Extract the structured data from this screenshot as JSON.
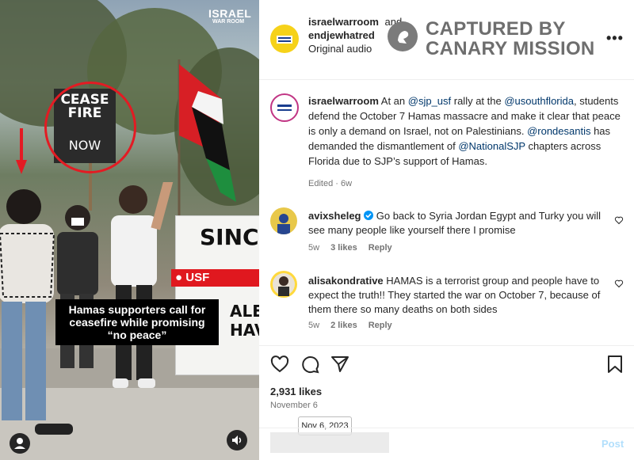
{
  "video": {
    "watermark_line1": "ISRAEL",
    "watermark_line2": "WAR ROOM",
    "sign_text_top": "CEASE FIRE",
    "sign_text_bottom": "NOW",
    "banner_text": "SINCE",
    "banner_fragment1": "ALEST",
    "banner_fragment2": "HAVE",
    "location_tag": "USF",
    "caption_line1": "Hamas supporters call for",
    "caption_line2": "ceasefire while promising",
    "caption_line3": "“no peace”",
    "accent_red": "#e0181f"
  },
  "header": {
    "user1": "israelwarroom",
    "joiner": "and",
    "user2": "endjewhatred",
    "audio": "Original audio",
    "watermark_line1": "CAPTURED BY",
    "watermark_line2": "CANARY MISSION",
    "more_icon": "more-horizontal-icon"
  },
  "caption": {
    "username": "israelwarroom",
    "t1": " At an ",
    "m1": "@sjp_usf",
    "t2": " rally at the ",
    "m2": "@usouthflorida",
    "t3": ", students defend the October 7 Hamas massacre and make it clear that peace is only a demand on Israel, not on Palestinians. ",
    "m3": "@rondesantis",
    "t4": " has demanded the dismantlement of ",
    "m4": "@NationalSJP",
    "t5": " chapters across Florida due to SJP’s support of Hamas.",
    "meta": "Edited · 6w"
  },
  "comments": [
    {
      "username": "avixsheleg",
      "verified": true,
      "text": " Go back to Syria Jordan Egypt and Turky you will see many people like yourself there I promise",
      "time": "5w",
      "likes": "3 likes",
      "reply": "Reply"
    },
    {
      "username": "alisakondrative",
      "verified": false,
      "text": " HAMAS is a terrorist group and people have to expect the truth!! They started the war on October 7, because of them there so many deaths on both sides",
      "time": "5w",
      "likes": "2 likes",
      "reply": "Reply"
    }
  ],
  "footer": {
    "likes": "2,931 likes",
    "date": "November 6",
    "tooltip": "Nov 6, 2023",
    "post": "Post",
    "accent_blue": "#0095f6"
  }
}
